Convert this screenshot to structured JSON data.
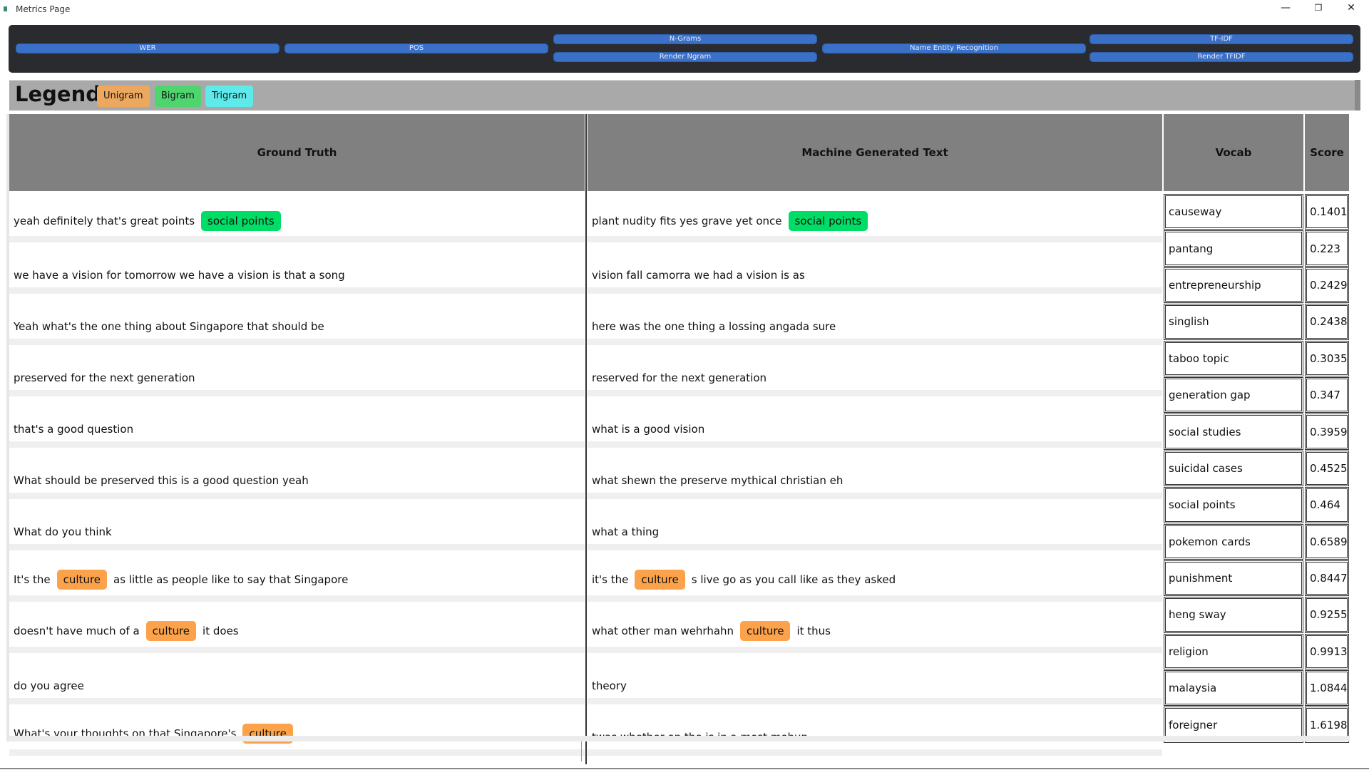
{
  "window": {
    "title": "Metrics Page",
    "controls": {
      "minimize": "—",
      "maximize": "❐",
      "close": "✕"
    }
  },
  "nav": {
    "wer": "WER",
    "pos": "POS",
    "ngrams": "N-Grams",
    "render_ngram": "Render Ngram",
    "ner": "Name Entity Recognition",
    "tfidf": "TF-IDF",
    "render_tfidf": "Render TFIDF"
  },
  "legend": {
    "title": "Legend:",
    "items": [
      {
        "label": "Unigram",
        "color": "#eda85f"
      },
      {
        "label": "Bigram",
        "color": "#4fd56e"
      },
      {
        "label": "Trigram",
        "color": "#5eeaea"
      }
    ]
  },
  "table": {
    "headers": {
      "ground_truth": "Ground Truth",
      "machine": "Machine Generated Text",
      "vocab": "Vocab",
      "score": "Score"
    },
    "rows": [
      {
        "gt": [
          {
            "t": "yeah definitely that's great points"
          },
          {
            "hl": "social points",
            "type": "bigram"
          }
        ],
        "mt": [
          {
            "t": "plant nudity fits yes grave yet once"
          },
          {
            "hl": "social points",
            "type": "bigram"
          }
        ]
      },
      {
        "gt": [
          {
            "t": "we have a vision for tomorrow we have a vision is that a song"
          }
        ],
        "mt": [
          {
            "t": "vision fall camorra we had a vision is as"
          }
        ]
      },
      {
        "gt": [
          {
            "t": "Yeah what's the one thing about Singapore that should be"
          }
        ],
        "mt": [
          {
            "t": "here was the one thing a lossing angada sure"
          }
        ]
      },
      {
        "gt": [
          {
            "t": "preserved for the next generation"
          }
        ],
        "mt": [
          {
            "t": "reserved for the next generation"
          }
        ]
      },
      {
        "gt": [
          {
            "t": "that's a good question"
          }
        ],
        "mt": [
          {
            "t": "what is a good vision"
          }
        ]
      },
      {
        "gt": [
          {
            "t": "What should be preserved this is a good question yeah"
          }
        ],
        "mt": [
          {
            "t": "what shewn the preserve mythical christian eh"
          }
        ]
      },
      {
        "gt": [
          {
            "t": "What do you think"
          }
        ],
        "mt": [
          {
            "t": "what a thing"
          }
        ]
      },
      {
        "gt": [
          {
            "t": "It's the"
          },
          {
            "hl": "culture",
            "type": "unigram"
          },
          {
            "t": "as little as people like to say that Singapore"
          }
        ],
        "mt": [
          {
            "t": "it's the"
          },
          {
            "hl": "culture",
            "type": "unigram"
          },
          {
            "t": "s live go as you call like as they asked"
          }
        ]
      },
      {
        "gt": [
          {
            "t": "doesn't have much of a"
          },
          {
            "hl": "culture",
            "type": "unigram"
          },
          {
            "t": "it does"
          }
        ],
        "mt": [
          {
            "t": "what other man wehrhahn"
          },
          {
            "hl": "culture",
            "type": "unigram"
          },
          {
            "t": "it thus"
          }
        ]
      },
      {
        "gt": [
          {
            "t": "do you agree"
          }
        ],
        "mt": [
          {
            "t": "theory"
          }
        ]
      },
      {
        "gt": [
          {
            "t": "What's your thoughts on that Singapore's"
          },
          {
            "hl": "culture",
            "type": "unigram"
          }
        ],
        "mt": [
          {
            "t": "twas whether on the is in a most mohun"
          }
        ]
      }
    ],
    "vocab": [
      {
        "word": "causeway",
        "score": "0.1401"
      },
      {
        "word": "pantang",
        "score": "0.223"
      },
      {
        "word": "entrepreneurship",
        "score": "0.2429"
      },
      {
        "word": "singlish",
        "score": "0.2438"
      },
      {
        "word": "taboo topic",
        "score": "0.3035"
      },
      {
        "word": "generation gap",
        "score": "0.347"
      },
      {
        "word": "social studies",
        "score": "0.3959"
      },
      {
        "word": "suicidal cases",
        "score": "0.4525"
      },
      {
        "word": "social points",
        "score": "0.464"
      },
      {
        "word": "pokemon cards",
        "score": "0.6589"
      },
      {
        "word": "punishment",
        "score": "0.8447"
      },
      {
        "word": "heng sway",
        "score": "0.9255"
      },
      {
        "word": "religion",
        "score": "0.9913"
      },
      {
        "word": "malaysia",
        "score": "1.0844"
      },
      {
        "word": "foreigner",
        "score": "1.6198"
      }
    ]
  }
}
